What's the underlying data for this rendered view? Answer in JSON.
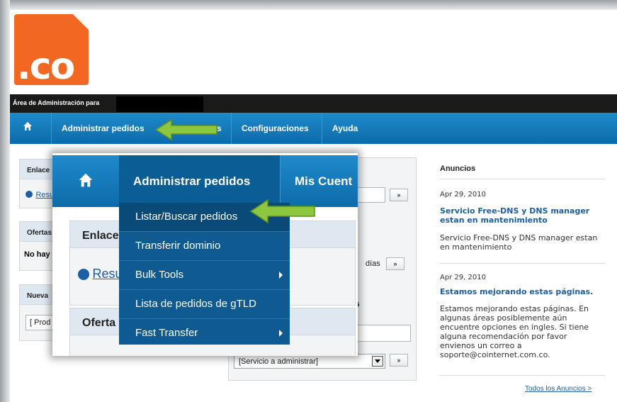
{
  "logo": {
    "text": ".co"
  },
  "admin_bar": {
    "label": "Área de Administración para"
  },
  "nav": {
    "items": [
      "Administrar pedidos",
      "s",
      "Configuraciones",
      "Ayuda"
    ]
  },
  "left_boxes": {
    "enlaces": {
      "title": "Enlace",
      "link": "Resu"
    },
    "ofertas": {
      "title": "Ofertas",
      "text": "No hay"
    },
    "nueva": {
      "title": "Nueva",
      "value": "[ Prod"
    }
  },
  "middle": {
    "go_label": "»",
    "days_label": "días",
    "service_select": "[Servicio a administrar]",
    "service_title": "s"
  },
  "announcements": {
    "title": "Anuncios",
    "items": [
      {
        "date": "Apr 29, 2010",
        "headline": "Servicio Free-DNS y DNS manager estan en mantenimiento",
        "body": "Servicio Free-DNS y DNS manager estan en mantenimiento"
      },
      {
        "date": "Apr 29, 2010",
        "headline": "Estamos mejorando estas páginas.",
        "body": "Estamos mejorando estas páginas. En algunas áreas posiblemente aún encuentre opciones en ingles. Si tiene alguna recomendación por favor envienos un correo a soporte@cointernet.com.co."
      }
    ],
    "all_link": "Todos los Anuncios >"
  },
  "zoom": {
    "nav_active": "Administrar pedidos",
    "nav_next": "Mis Cuent",
    "box1_title": "Enlace",
    "box1_link": "Resu",
    "box2_title": "Oferta",
    "dropdown": [
      "Listar/Buscar pedidos",
      "Transferir dominio",
      "Bulk Tools",
      "Lista de pedidos de gTLD",
      "Fast Transfer"
    ]
  },
  "colors": {
    "brand": "#f26722",
    "nav": "#1e8bcb",
    "dropdown": "#0f5b91",
    "arrow": "#8dc63f"
  }
}
